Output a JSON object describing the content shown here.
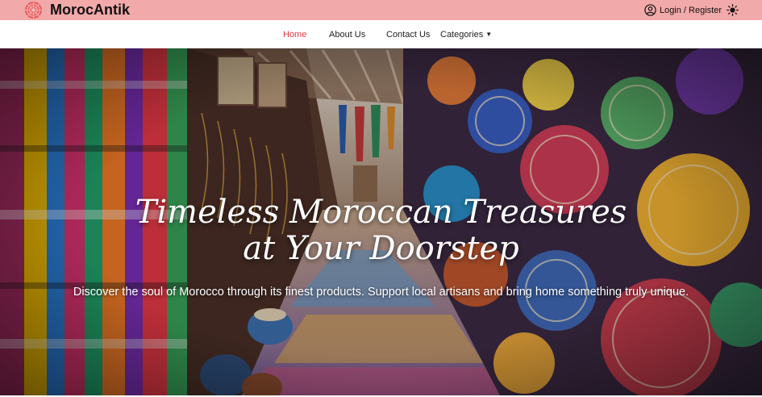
{
  "brand": {
    "name": "MorocAntik",
    "logo_icon": "mandala-icon",
    "accent": "#f2a9a9"
  },
  "header": {
    "login_label": "Login / Register",
    "user_icon": "user-circle-icon",
    "theme_icon": "sun-icon"
  },
  "nav": {
    "items": [
      {
        "label": "Home",
        "active": true
      },
      {
        "label": "About Us"
      },
      {
        "label": "Contact Us"
      },
      {
        "label": "Categories",
        "dropdown": true
      }
    ],
    "active_color": "#e23b3b"
  },
  "hero": {
    "title_line1": "Timeless Moroccan Treasures",
    "title_line2": "at Your Doorstep",
    "subtitle": "Discover the soul of Morocco through its finest products. Support local artisans and bring home something truly unique."
  }
}
